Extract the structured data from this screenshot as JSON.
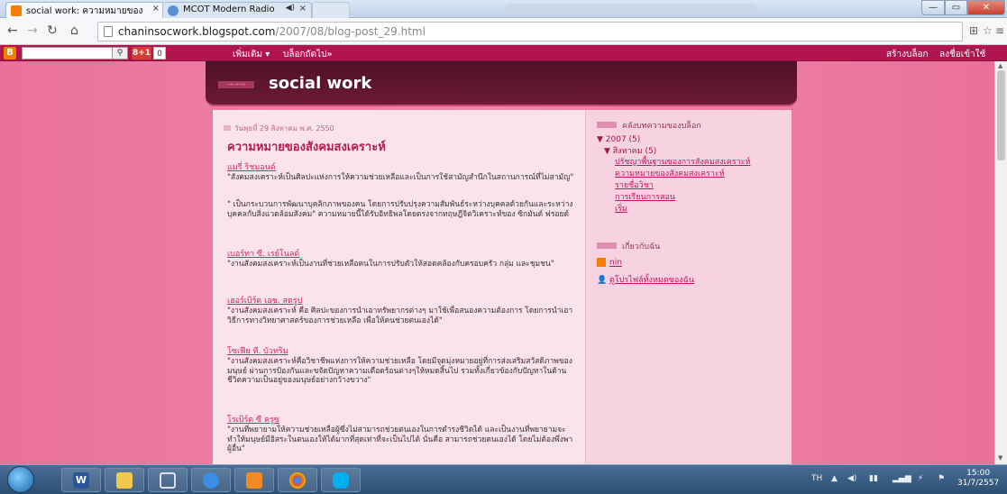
{
  "browser": {
    "tabs": [
      {
        "title": "social work: ความหมายของ",
        "active": true
      },
      {
        "title": "MCOT Modern Radio",
        "active": false
      }
    ],
    "url_host": "chaninsocwork.blogspot.com",
    "url_path": "/2007/08/blog-post_29.html"
  },
  "blogger_nav": {
    "plus_label": "8+1",
    "plus_count": "0",
    "more_label": "เพิ่มเติม ▾",
    "next_blog": "บล็อกถัดไป»",
    "create_blog": "สร้างบล็อก",
    "sign_in": "ลงชื่อเข้าใช้"
  },
  "blog": {
    "title": "social work"
  },
  "post": {
    "date": "วันพุธที่ 29 สิงหาคม พ.ศ. 2550",
    "title": "ความหมายของสังคมสงเคราะห์",
    "entries": [
      {
        "author": "แมรี่ ริชมอนด์",
        "text": "\"สังคมสงเคราะห์เป็นศิลปะแห่งการให้ความช่วยเหลือและเป็นการใช้สามัญสำนึกในสถานการณ์ที่ไม่สามัญ\""
      },
      {
        "author": "",
        "text": "\" เป็นกระบวนการพัฒนาบุคลิกภาพของคน โดยการปรับปรุงความสัมพันธ์ระหว่างบุคคลด้วยกันและระหว่างบุคคลกับสิ่งแวดล้อมสังคม\" ความหมายนี้ได้รับอิทธิพลโดยตรงจากทฤษฎีจิตวิเคราะห์ของ ซิกมันด์ ฟรอยด์"
      },
      {
        "author": "เบอร์ทา ซี. เรย์โนลด์",
        "text": "\"งานสังคมสงเคราะห์เป็นงานที่ช่วยเหลือคนในการปรับตัวให้สอดคล้องกับครอบครัว กลุ่ม และชุมชน\""
      },
      {
        "author": "เฮอร์เบิร์ต เอช. สตรูป",
        "text": "\"งานสังคมสงเคราะห์ คือ ศิลปะของการนำเอาทรัพยากรต่างๆ มาใช้เพื่อสนองความต้องการ โดยการนำเอาวิธีการทางวิทยาศาสตร์ของการช่วยเหลือ เพื่อให้คนช่วยตนเองได้\""
      },
      {
        "author": "โซเฟีย ที. บัวทริม",
        "text": "\"งานสังคมสงเคราะห์คือวิชาชีพแห่งการให้ความช่วยเหลือ โดยมีจุดมุ่งหมายอยู่ที่การส่งเสริมสวัสดิภาพของมนุษย์ ผ่านการป้องกันและขจัดปัญหาความเดือดร้อนต่างๆให้หมดสิ้นไป รวมทั้งเกี่ยวข้องกับปัญหาในด้านชีวิตความเป็นอยู่ของมนุษย์อย่างกว้างขวาง\""
      },
      {
        "author": "โรเบิร์ต ซี ครูซ",
        "text": "\"งานที่พยายามให้ความช่วยเหลือผู้ซึ่งไม่สามารถช่วยตนเองในการดำรงชีวิตได้ และเป็นงานที่พยายามจะทำให้มนุษย์มีอิสระในตนเองให้ได้มากที่สุดเท่าที่จะเป็นไปได้ นั่นคือ สามารถช่วยตนเองได้ โดยไม่ต้องพึ่งพาผู้อื่น\""
      }
    ]
  },
  "sidebar": {
    "archive_heading": "คลังบทความของบล็อก",
    "year": "▼ 2007 (5)",
    "month": "▼ สิงหาคม (5)",
    "posts": [
      "ปรัชญาพื้นฐานของการสังคมสงเคราะห์",
      "ความหมายของสังคมสงเคราะห์",
      "รายชื่อวิชา",
      "การเรียนการสอน",
      "เริ่ม"
    ],
    "about_heading": "เกี่ยวกับฉัน",
    "profile_name": "nin",
    "view_profile": "ดูโปรไฟล์ทั้งหมดของฉัน"
  },
  "taskbar": {
    "language": "TH",
    "time": "15:00",
    "date": "31/7/2557"
  }
}
